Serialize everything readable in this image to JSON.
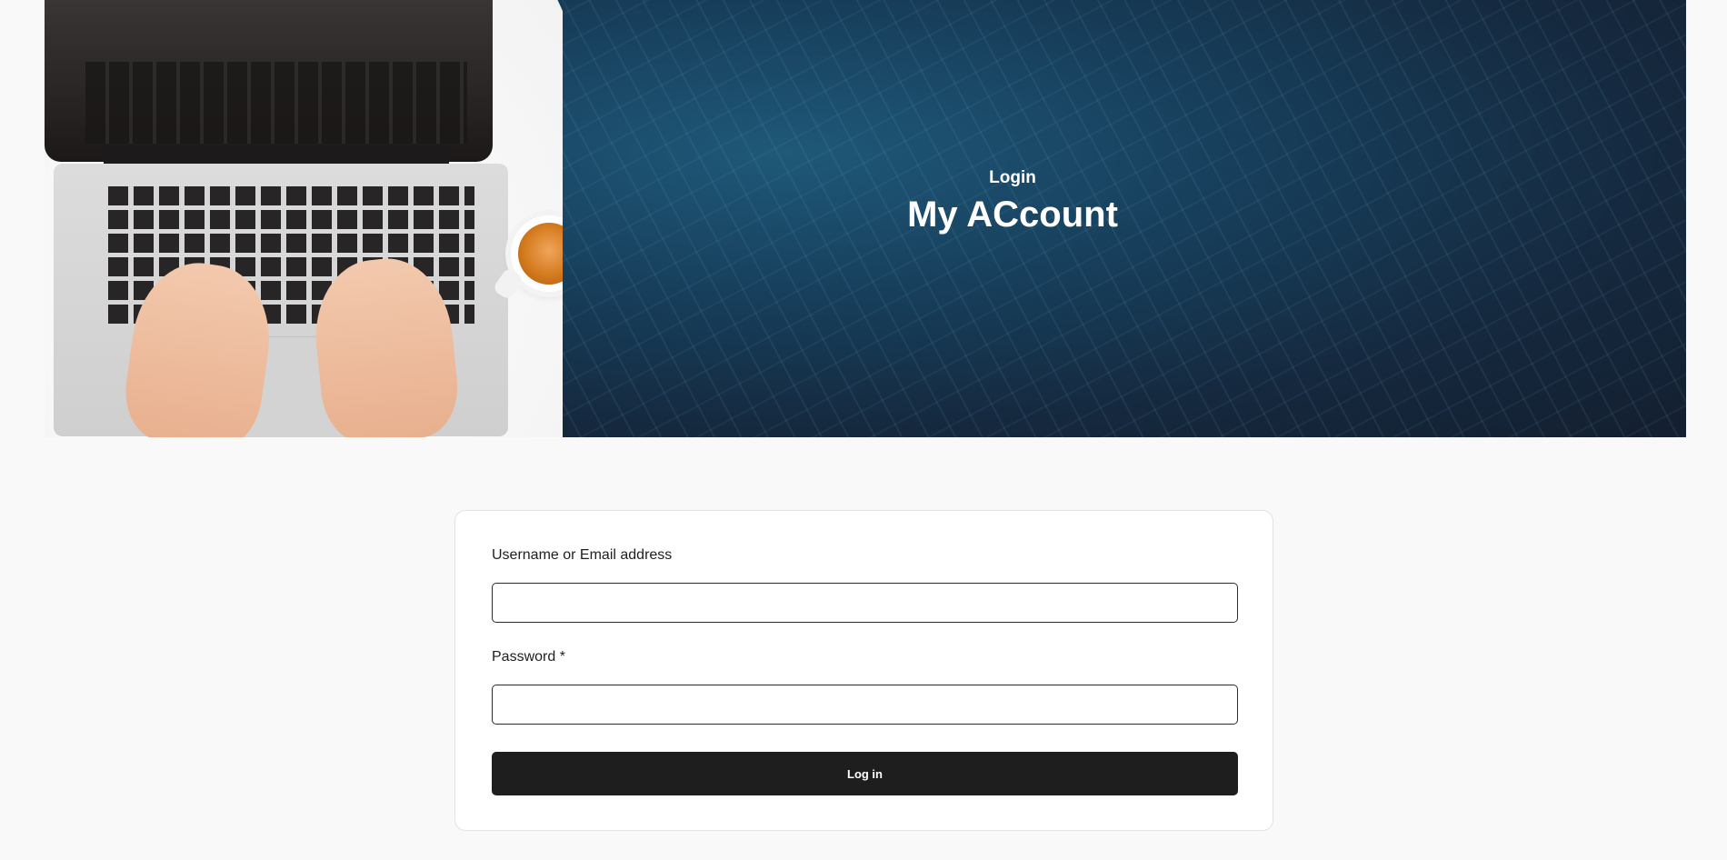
{
  "hero": {
    "subtitle": "Login",
    "title": "My ACcount",
    "image_alt": "hands typing on laptop keyboard beside a cup of tea"
  },
  "login_form": {
    "username_label": "Username or Email address",
    "username_value": "",
    "password_label": "Password *",
    "password_value": "",
    "submit_label": "Log in"
  },
  "colors": {
    "page_background": "#f9f9f9",
    "hero_background": "#173f5c",
    "button_background": "#1e1e1e",
    "button_text": "#ffffff"
  }
}
